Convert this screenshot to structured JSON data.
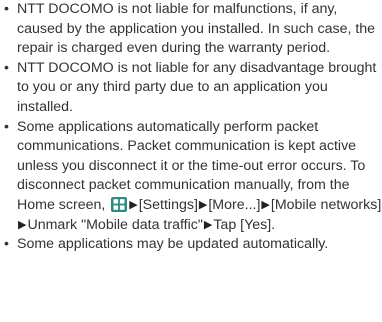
{
  "colors": {
    "text": "#333333",
    "menu_icon": "#2a8c84"
  },
  "bullet_char": "•",
  "arrow_char": "▶",
  "items": [
    {
      "text": "NTT DOCOMO is not liable for malfunctions, if any, caused by the application you installed. In such case, the repair is charged even during the warranty period."
    },
    {
      "text": "NTT DOCOMO is not liable for any disadvantage brought to you or any third party due to an application you installed."
    },
    {
      "text_before": "Some applications automatically perform packet communications. Packet communication is kept active unless you disconnect it or the time-out error occurs. To disconnect packet communication manually, from the Home screen,",
      "icon": "apps-grid-icon",
      "steps": [
        "[Settings]",
        "[More...]",
        "[Mobile networks]",
        "Unmark \"Mobile data traffic\"",
        "Tap [Yes]."
      ]
    },
    {
      "text": "Some applications may be updated automatically."
    }
  ]
}
